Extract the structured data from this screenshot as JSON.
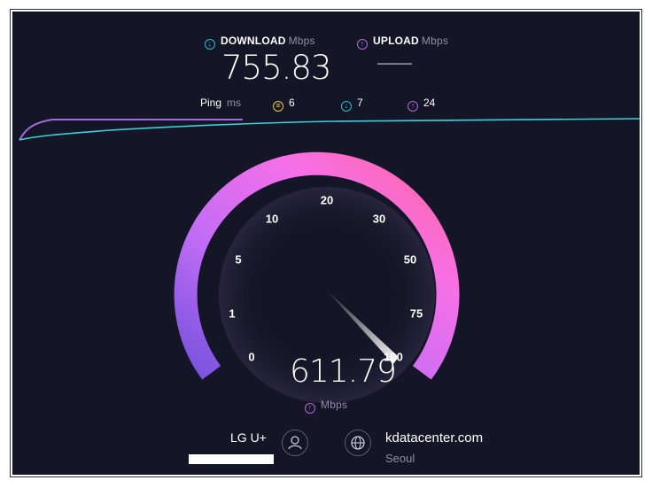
{
  "download": {
    "label": "DOWNLOAD",
    "unit": "Mbps",
    "value": "755.83",
    "icon": "download-arrow-icon",
    "color": "#22c0d0"
  },
  "upload": {
    "label": "UPLOAD",
    "unit": "Mbps",
    "value": "——",
    "icon": "upload-arrow-icon",
    "color": "#b36ad8"
  },
  "ping": {
    "label": "Ping",
    "unit": "ms",
    "idle": {
      "icon": "latency-idle-icon",
      "value": "6",
      "color": "#e8c94a"
    },
    "down": {
      "icon": "latency-download-icon",
      "value": "7",
      "color": "#22c0d0"
    },
    "up": {
      "icon": "latency-upload-icon",
      "value": "24",
      "color": "#b36ad8"
    }
  },
  "gauge": {
    "ticks": [
      "0",
      "1",
      "5",
      "10",
      "20",
      "30",
      "50",
      "75",
      "100"
    ],
    "current": "611.79",
    "unit": "Mbps",
    "current_level": 1.0,
    "gradient": [
      "#7f5ae6",
      "#c06af6",
      "#f46fe4",
      "#ff6aa6"
    ]
  },
  "isp": {
    "name": "LG U+",
    "icon": "user-icon"
  },
  "server": {
    "name": "kdatacenter.com",
    "location": "Seoul",
    "icon": "globe-icon"
  },
  "colors": {
    "background": "#141526",
    "download_line": "#3cd0d8",
    "upload_line": "#a46ae0"
  }
}
